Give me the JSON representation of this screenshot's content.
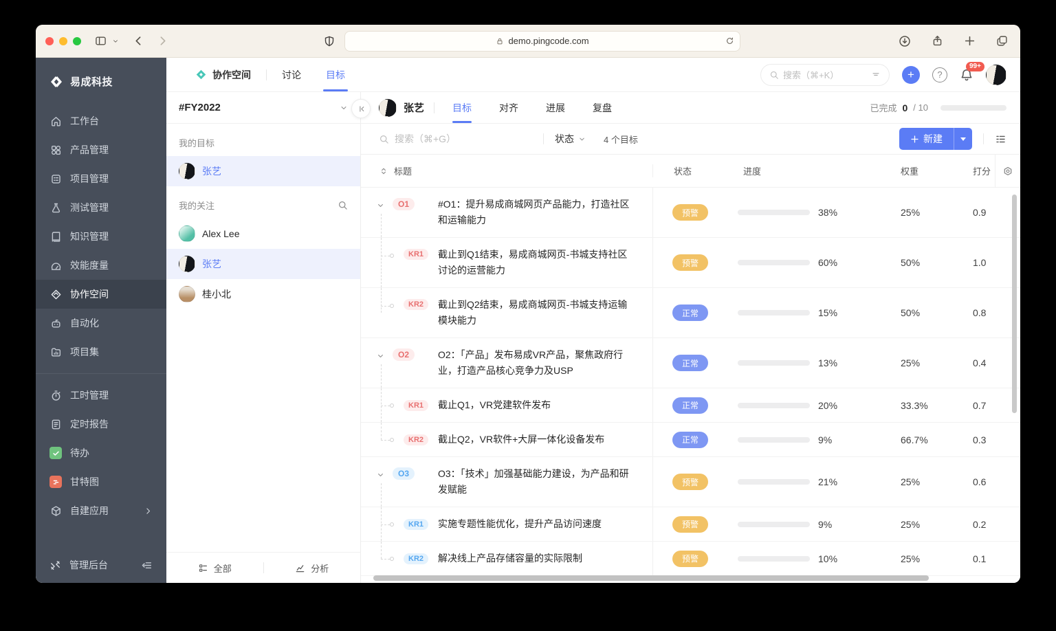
{
  "browser": {
    "url": "demo.pingcode.com"
  },
  "app": {
    "workspace_name": "易成科技",
    "sidebar": {
      "groups": [
        [
          {
            "label": "工作台",
            "icon": "home"
          },
          {
            "label": "产品管理",
            "icon": "grid"
          },
          {
            "label": "项目管理",
            "icon": "clipboard"
          },
          {
            "label": "测试管理",
            "icon": "flask"
          },
          {
            "label": "知识管理",
            "icon": "book"
          },
          {
            "label": "效能度量",
            "icon": "gauge"
          },
          {
            "label": "协作空间",
            "icon": "collab",
            "active": true
          },
          {
            "label": "自动化",
            "icon": "robot"
          },
          {
            "label": "项目集",
            "icon": "folder"
          }
        ],
        [
          {
            "label": "工时管理",
            "icon": "stopwatch"
          },
          {
            "label": "定时报告",
            "icon": "doc"
          },
          {
            "label": "待办",
            "icon": "todo",
            "tile": "green"
          },
          {
            "label": "甘特图",
            "icon": "gantt",
            "tile": "red"
          },
          {
            "label": "自建应用",
            "icon": "cube",
            "chevron": true
          }
        ]
      ],
      "footer_label": "管理后台"
    },
    "topbar": {
      "nav": [
        {
          "label": "协作空间",
          "icon": "collab-color"
        },
        {
          "label": "讨论"
        },
        {
          "label": "目标",
          "active": true
        }
      ],
      "search_placeholder": "搜索（⌘+K）",
      "notification_badge": "99+"
    },
    "panel": {
      "period": "#FY2022",
      "my_goals_label": "我的目标",
      "my_goals": [
        {
          "name": "张艺",
          "avatar": "zy",
          "selected": true
        }
      ],
      "following_label": "我的关注",
      "following": [
        {
          "name": "Alex Lee",
          "avatar": "alex",
          "selected": false
        },
        {
          "name": "张艺",
          "avatar": "zy",
          "selected": true
        },
        {
          "name": "桂小北",
          "avatar": "gui",
          "selected": false
        }
      ],
      "footer": {
        "all_label": "全部",
        "analysis_label": "分析"
      }
    },
    "main": {
      "user": "张艺",
      "tabs": [
        {
          "label": "目标",
          "active": true
        },
        {
          "label": "对齐"
        },
        {
          "label": "进展"
        },
        {
          "label": "复盘"
        }
      ],
      "completed": {
        "label": "已完成",
        "count": "0",
        "divider": "/",
        "total": "10"
      },
      "toolbar": {
        "search_placeholder": "搜索（⌘+G）",
        "status_filter_label": "状态",
        "goal_count": "4 个目标",
        "new_button_label": "新建"
      },
      "table": {
        "columns": [
          "标题",
          "状态",
          "进度",
          "权重",
          "打分"
        ],
        "rows": [
          {
            "kind": "O",
            "badge": "O1",
            "badge_color": "red",
            "title": "#O1：提升易成商城网页产品能力，打造社区和运输能力",
            "status": "预警",
            "status_type": "warning",
            "progress": 38,
            "progress_label": "38%",
            "weight": "25%",
            "score": "0.9",
            "lines": 2
          },
          {
            "kind": "KR",
            "badge": "KR1",
            "badge_color": "red",
            "title": "截止到Q1结束，易成商城网页-书城支持社区讨论的运营能力",
            "status": "预警",
            "status_type": "warning",
            "progress": 60,
            "progress_label": "60%",
            "weight": "50%",
            "score": "1.0",
            "lines": 2
          },
          {
            "kind": "KR",
            "badge": "KR2",
            "badge_color": "red",
            "title": "截止到Q2结束，易成商城网页-书城支持运输模块能力",
            "status": "正常",
            "status_type": "normal",
            "progress": 15,
            "progress_label": "15%",
            "weight": "50%",
            "score": "0.8",
            "lines": 2,
            "last": true
          },
          {
            "kind": "O",
            "badge": "O2",
            "badge_color": "red",
            "title": "O2：「产品」发布易成VR产品，聚焦政府行业，打造产品核心竞争力及USP",
            "status": "正常",
            "status_type": "normal",
            "progress": 13,
            "progress_label": "13%",
            "weight": "25%",
            "score": "0.4",
            "lines": 2
          },
          {
            "kind": "KR",
            "badge": "KR1",
            "badge_color": "red",
            "title": "截止Q1，VR党建软件发布",
            "status": "正常",
            "status_type": "normal",
            "progress": 20,
            "progress_label": "20%",
            "weight": "33.3%",
            "score": "0.7",
            "lines": 1
          },
          {
            "kind": "KR",
            "badge": "KR2",
            "badge_color": "red",
            "title": "截止Q2，VR软件+大屏一体化设备发布",
            "status": "正常",
            "status_type": "normal",
            "progress": 9,
            "progress_label": "9%",
            "weight": "66.7%",
            "score": "0.3",
            "lines": 1,
            "last": true
          },
          {
            "kind": "O",
            "badge": "O3",
            "badge_color": "blue",
            "title": "O3：「技术」加强基础能力建设，为产品和研发赋能",
            "status": "预警",
            "status_type": "warning",
            "progress": 21,
            "progress_label": "21%",
            "weight": "25%",
            "score": "0.6",
            "lines": 2
          },
          {
            "kind": "KR",
            "badge": "KR1",
            "badge_color": "blue",
            "title": "实施专题性能优化，提升产品访问速度",
            "status": "预警",
            "status_type": "warning",
            "progress": 9,
            "progress_label": "9%",
            "weight": "25%",
            "score": "0.2",
            "lines": 1
          },
          {
            "kind": "KR",
            "badge": "KR2",
            "badge_color": "blue",
            "title": "解决线上产品存储容量的实际限制",
            "status": "预警",
            "status_type": "warning",
            "progress": 10,
            "progress_label": "10%",
            "weight": "25%",
            "score": "0.1",
            "lines": 1,
            "last": true
          }
        ]
      }
    }
  },
  "colors": {
    "accent_blue": "#5B7CF5",
    "status_warning": "#F2C265",
    "status_normal": "#7E97F3",
    "progress_green": "#85C990",
    "badge_red_bg": "#FDECEC",
    "badge_red_text": "#E87070",
    "badge_blue_bg": "#E4F2FD",
    "badge_blue_text": "#55A7F0",
    "sidebar_bg": "#474E5A",
    "notification_red": "#F15B50"
  }
}
